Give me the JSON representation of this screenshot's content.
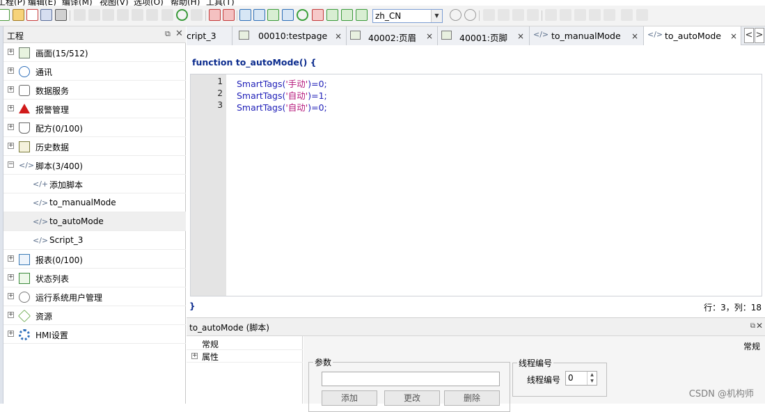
{
  "menubar": {
    "items": [
      "工程(P)",
      "编辑(E)",
      "编译(M)",
      "视图(V)",
      "选项(O)",
      "帮助(H)",
      "工具(T)"
    ]
  },
  "toolbar": {
    "language_value": "zh_CN"
  },
  "project_panel": {
    "title": "工程",
    "float_icon": "float-window-icon",
    "close_icon": "close-icon",
    "items": [
      {
        "label": "画面(15/512)",
        "icon": "screen-icon",
        "expand": "+",
        "level": 0
      },
      {
        "label": "通讯",
        "icon": "globe-icon",
        "expand": "+",
        "level": 0
      },
      {
        "label": "数据服务",
        "icon": "database-icon",
        "expand": "+",
        "level": 0
      },
      {
        "label": "报警管理",
        "icon": "alarm-warning-icon",
        "expand": "+",
        "level": 0
      },
      {
        "label": "配方(0/100)",
        "icon": "flask-icon",
        "expand": "+",
        "level": 0
      },
      {
        "label": "历史数据",
        "icon": "binary-history-icon",
        "expand": "+",
        "level": 0
      },
      {
        "label": "脚本(3/400)",
        "icon": "script-icon",
        "expand": "−",
        "level": 0
      },
      {
        "label": "添加脚本",
        "icon": "add-script-icon",
        "expand": "",
        "level": 1
      },
      {
        "label": "to_manualMode",
        "icon": "script-icon",
        "expand": "",
        "level": 1
      },
      {
        "label": "to_autoMode",
        "icon": "script-icon",
        "expand": "",
        "level": 1,
        "selected": true
      },
      {
        "label": "Script_3",
        "icon": "script-icon",
        "expand": "",
        "level": 1
      },
      {
        "label": "报表(0/100)",
        "icon": "report-icon",
        "expand": "+",
        "level": 0
      },
      {
        "label": "状态列表",
        "icon": "list-document-icon",
        "expand": "+",
        "level": 0
      },
      {
        "label": "运行系统用户管理",
        "icon": "user-icon",
        "expand": "+",
        "level": 0
      },
      {
        "label": "资源",
        "icon": "resource-icon",
        "expand": "+",
        "level": 0
      },
      {
        "label": "HMI设置",
        "icon": "gear-icon",
        "expand": "+",
        "level": 0
      }
    ]
  },
  "tabs": [
    {
      "label": "cript_3",
      "icon": "",
      "active": false
    },
    {
      "label": "00010:testpage",
      "icon": "screen-icon",
      "active": false
    },
    {
      "label": "40002:页眉",
      "icon": "screen-icon",
      "active": false
    },
    {
      "label": "40001:页脚",
      "icon": "screen-icon",
      "active": false
    },
    {
      "label": "to_manualMode",
      "icon": "script-icon",
      "active": false
    },
    {
      "label": "to_autoMode",
      "icon": "script-icon",
      "active": true
    }
  ],
  "tab_close": "×",
  "tab_nav": {
    "prev": "<",
    "next": ">"
  },
  "editor": {
    "function_header": "function to_autoMode() {",
    "closing_brace": "}",
    "cursor_position": "行：3，列：18",
    "lines": [
      {
        "number": "1",
        "prefix": "SmartTags(",
        "string": "'手动'",
        "suffix": ")=0;"
      },
      {
        "number": "2",
        "prefix": "SmartTags(",
        "string": "'自动'",
        "suffix": ")=1;"
      },
      {
        "number": "3",
        "prefix": "SmartTags(",
        "string": "'自动'",
        "suffix": ")=0;"
      }
    ]
  },
  "properties": {
    "title": "to_autoMode (脚本)",
    "tree": [
      {
        "label": "常规",
        "expand": ""
      },
      {
        "label": "属性",
        "expand": "+"
      }
    ],
    "category_label": "常规",
    "params_group": "参数",
    "params_input_value": "",
    "buttons": [
      "添加",
      "更改",
      "删除"
    ],
    "thread_group": "线程编号",
    "thread_label": "线程编号",
    "thread_value": "0"
  },
  "watermark": "CSDN @机构师"
}
